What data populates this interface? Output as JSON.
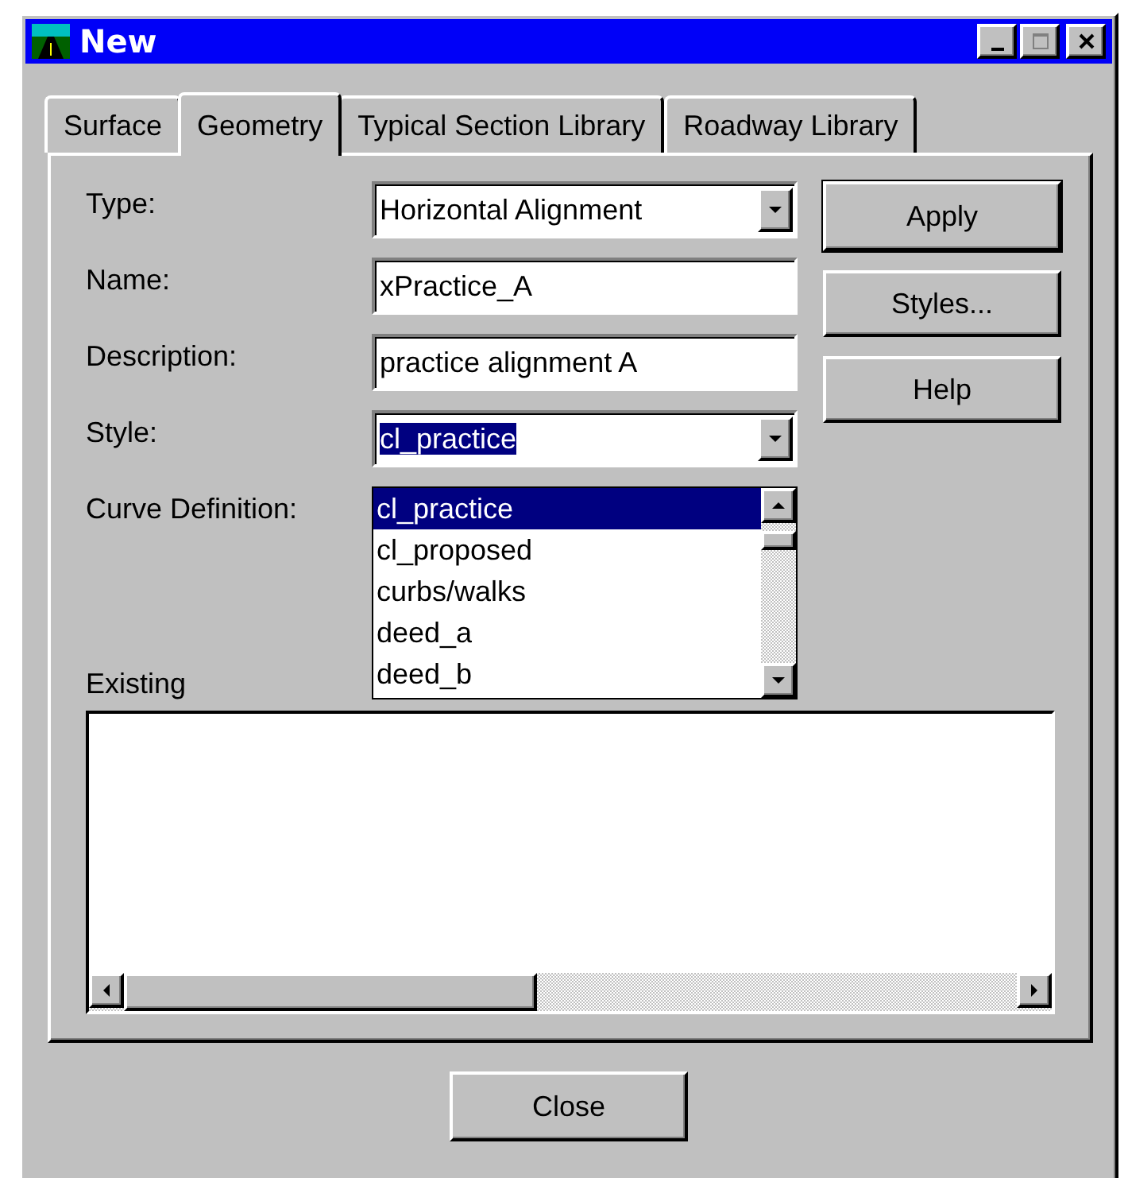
{
  "window": {
    "title": "New"
  },
  "tabs": [
    {
      "label": "Surface",
      "selected": false
    },
    {
      "label": "Geometry",
      "selected": true
    },
    {
      "label": "Typical Section Library",
      "selected": false
    },
    {
      "label": "Roadway Library",
      "selected": false
    }
  ],
  "fields": [
    {
      "label": "Type:",
      "kind": "dropdown",
      "value": "Horizontal Alignment",
      "highlighted": false
    },
    {
      "label": "Name:",
      "kind": "text",
      "value": "xPractice_A",
      "highlighted": false
    },
    {
      "label": "Description:",
      "kind": "text",
      "value": "practice alignment A",
      "highlighted": false
    },
    {
      "label": "Style:",
      "kind": "dropdown",
      "value": "cl_practice",
      "highlighted": true
    }
  ],
  "curve_definition": {
    "label": "Curve Definition:"
  },
  "style_options": [
    {
      "label": "cl_practice",
      "selected": true
    },
    {
      "label": "cl_proposed",
      "selected": false
    },
    {
      "label": "curbs/walks",
      "selected": false
    },
    {
      "label": "deed_a",
      "selected": false
    },
    {
      "label": "deed_b",
      "selected": false
    }
  ],
  "side_buttons": [
    {
      "label": "Apply",
      "default": true
    },
    {
      "label": "Styles...",
      "default": false
    },
    {
      "label": "Help",
      "default": false
    }
  ],
  "existing": {
    "label": "Existing"
  },
  "close_button": {
    "label": "Close"
  }
}
